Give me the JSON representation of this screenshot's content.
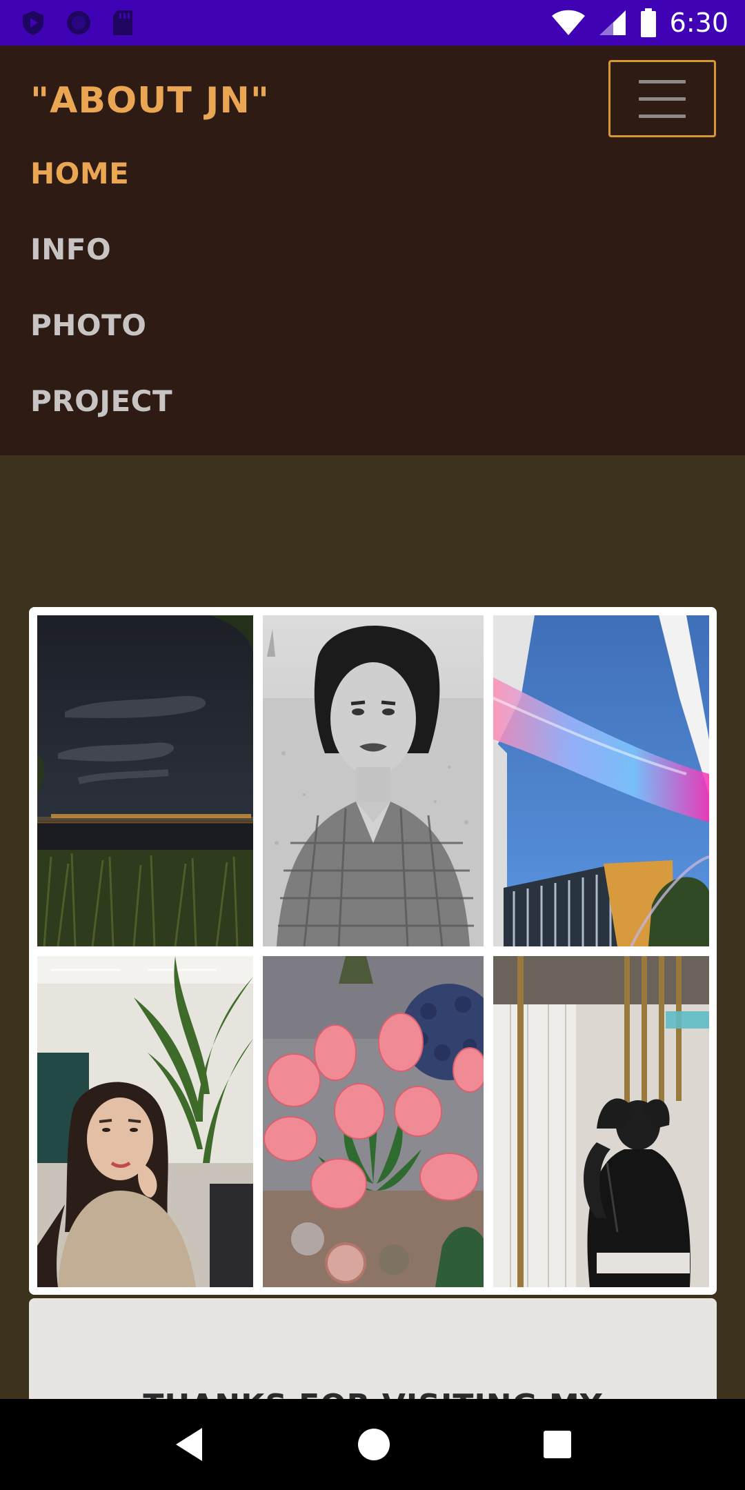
{
  "status_bar": {
    "time": "6:30",
    "icons_left": [
      "play-protect-icon",
      "circle-icon",
      "sd-card-icon"
    ],
    "icons_right": [
      "wifi-icon",
      "signal-icon",
      "battery-icon"
    ]
  },
  "navbar": {
    "brand": "\"ABOUT JN\"",
    "toggler": "hamburger-menu-icon",
    "items": [
      {
        "label": "HOME",
        "active": true
      },
      {
        "label": "INFO",
        "active": false
      },
      {
        "label": "PHOTO",
        "active": false
      },
      {
        "label": "PROJECT",
        "active": false
      }
    ]
  },
  "gallery": {
    "photos": [
      "night river landscape",
      "black and white portrait",
      "iridescent sculpture against sky",
      "portrait with plant",
      "pink tulips",
      "person in black jacket"
    ]
  },
  "footer": {
    "text": "THANKS FOR VISITING MY"
  },
  "colors": {
    "status_bar": "#3f03b5",
    "navbar_bg": "#2e1b13",
    "accent": "#eba654",
    "page_bg": "#3d331c"
  },
  "system_nav": {
    "back": "back-icon",
    "home": "home-icon",
    "recents": "recents-icon"
  }
}
